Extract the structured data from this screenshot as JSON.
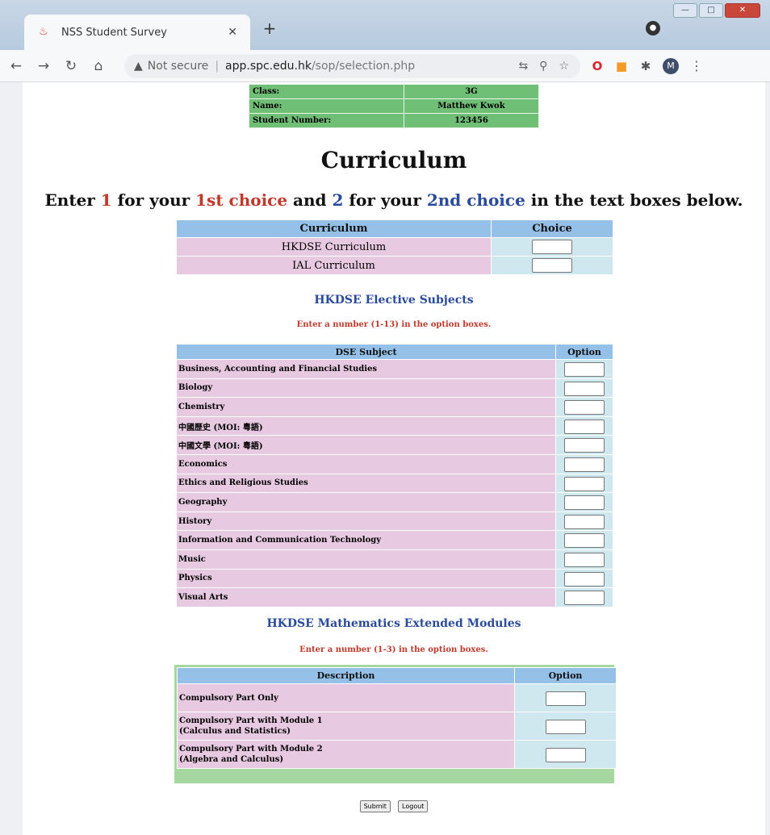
{
  "browser": {
    "tab_title": "NSS Student Survey",
    "url_warning": "Not secure",
    "url_host": "app.spc.edu.hk",
    "url_path": "/sop/selection.php",
    "avatar_letter": "M"
  },
  "student_info": {
    "rows": [
      {
        "label": "Class:",
        "value": "3G"
      },
      {
        "label": "Name:",
        "value": "Matthew Kwok"
      },
      {
        "label": "Student Number:",
        "value": "123456"
      }
    ]
  },
  "page": {
    "title": "Curriculum",
    "instruction": {
      "p1": "Enter ",
      "n1": "1",
      "p2": " for your ",
      "c1": "1st choice",
      "p3": " and ",
      "n2": "2",
      "p4": " for your ",
      "c2": "2nd choice",
      "p5": " in the text boxes below."
    }
  },
  "curriculum_table": {
    "headers": [
      "Curriculum",
      "Choice"
    ],
    "rows": [
      "HKDSE Curriculum",
      "IAL Curriculum"
    ]
  },
  "elective": {
    "heading": "HKDSE Elective Subjects",
    "note": "Enter a number (1-13) in the option boxes.",
    "headers": [
      "DSE Subject",
      "Option"
    ],
    "rows": [
      "Business, Accounting and Financial Studies",
      "Biology",
      "Chemistry",
      "中國歷史 (MOI: 粵語)",
      "中國文學 (MOI: 粵語)",
      "Economics",
      "Ethics and Religious Studies",
      "Geography",
      "History",
      "Information and Communication Technology",
      "Music",
      "Physics",
      "Visual Arts"
    ]
  },
  "math": {
    "heading": "HKDSE Mathematics Extended Modules",
    "note": "Enter a number (1-3) in the option boxes.",
    "headers": [
      "Description",
      "Option"
    ],
    "rows": [
      {
        "line1": "Compulsory Part Only",
        "line2": ""
      },
      {
        "line1": "Compulsory Part with Module 1",
        "line2": "(Calculus and Statistics)"
      },
      {
        "line1": "Compulsory Part with Module 2",
        "line2": "(Algebra and Calculus)"
      }
    ]
  },
  "buttons": {
    "submit": "Submit",
    "logout": "Logout"
  }
}
